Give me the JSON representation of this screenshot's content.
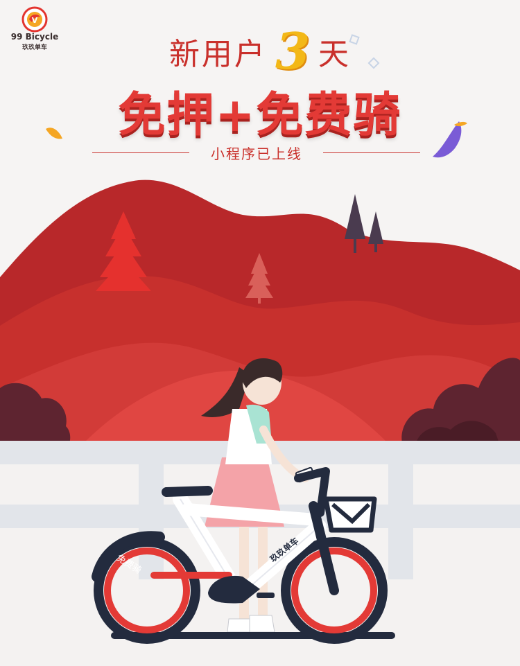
{
  "brand": {
    "name": "99 Bicycle",
    "subtitle": "玖玖单车"
  },
  "headline": {
    "prefix": "新用户",
    "days": "3",
    "suffix": "天"
  },
  "slogan": "免押+免费骑",
  "subline": "小程序已上线",
  "bike": {
    "frame_label": "玖玖单车",
    "fender_label": "免费骑"
  },
  "colors": {
    "brand_red": "#e33a36",
    "dark_red": "#b8282a",
    "accent_yellow": "#f3b817",
    "navy": "#232b3e"
  }
}
